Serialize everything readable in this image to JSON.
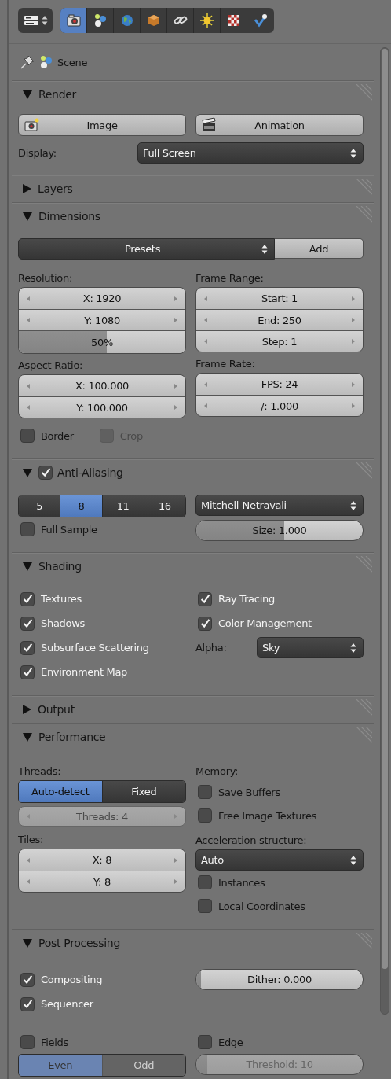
{
  "editor_selector": {
    "kind": "properties"
  },
  "tabs": [
    {
      "kind": "camera",
      "selected": true
    },
    {
      "kind": "scene",
      "selected": false
    },
    {
      "kind": "world",
      "selected": false
    },
    {
      "kind": "object",
      "selected": false
    },
    {
      "kind": "constraints",
      "selected": false
    },
    {
      "kind": "sun",
      "selected": false
    },
    {
      "kind": "texture",
      "selected": false
    },
    {
      "kind": "particles",
      "selected": false
    }
  ],
  "context": {
    "label": "Scene"
  },
  "panels": [
    {
      "kind": "render",
      "title": "Render",
      "expanded": true,
      "buttons": [
        {
          "kind": "image",
          "label": "Image"
        },
        {
          "kind": "animation",
          "label": "Animation"
        }
      ],
      "display": {
        "label": "Display:",
        "value": "Full Screen"
      }
    },
    {
      "title": "Layers",
      "expanded": false
    },
    {
      "kind": "dimensions",
      "title": "Dimensions",
      "expanded": true,
      "presets": "Presets",
      "add": "Add",
      "resolution": {
        "label": "Resolution:",
        "fields": [
          "X: 1920",
          "Y: 1080"
        ],
        "percent": {
          "text": "50%",
          "level": 0.5
        }
      },
      "frame_range": {
        "label": "Frame Range:",
        "fields": [
          "Start: 1",
          "End: 250",
          "Step: 1"
        ]
      },
      "aspect": {
        "label": "Aspect Ratio:",
        "fields": [
          "X: 100.000",
          "Y: 100.000"
        ]
      },
      "frame_rate": {
        "label": "Frame Rate:",
        "fields": [
          "FPS: 24",
          "/: 1.000"
        ]
      },
      "checks": [
        {
          "label": "Border",
          "checked": false,
          "disabled": false
        },
        {
          "label": "Crop",
          "checked": false,
          "disabled": true
        }
      ]
    },
    {
      "kind": "antialiasing",
      "title": "Anti-Aliasing",
      "expanded": true,
      "enabled": true,
      "samples": [
        {
          "label": "5",
          "selected": false
        },
        {
          "label": "8",
          "selected": true
        },
        {
          "label": "11",
          "selected": false
        },
        {
          "label": "16",
          "selected": false
        }
      ],
      "filter": "Mitchell-Netravali",
      "full_sample": {
        "label": "Full Sample",
        "checked": false
      },
      "size": {
        "text": "Size: 1.000",
        "level": 0.5
      }
    },
    {
      "kind": "shading",
      "title": "Shading",
      "expanded": true,
      "left": [
        {
          "label": "Textures",
          "checked": true
        },
        {
          "label": "Shadows",
          "checked": true
        },
        {
          "label": "Subsurface Scattering",
          "checked": true
        },
        {
          "label": "Environment Map",
          "checked": true
        }
      ],
      "right": [
        {
          "label": "Ray Tracing",
          "checked": true
        },
        {
          "label": "Color Management",
          "checked": true
        }
      ],
      "alpha": {
        "label": "Alpha:",
        "value": "Sky"
      }
    },
    {
      "title": "Output",
      "expanded": false
    },
    {
      "kind": "performance",
      "title": "Performance",
      "expanded": true,
      "threads_label": "Threads:",
      "thread_modes": [
        {
          "label": "Auto-detect",
          "selected": true
        },
        {
          "label": "Fixed",
          "selected": false
        }
      ],
      "threads": {
        "text": "Threads: 4",
        "disabled": true
      },
      "tiles_label": "Tiles:",
      "tiles": [
        "X: 8",
        "Y: 8"
      ],
      "memory_label": "Memory:",
      "memory": [
        {
          "label": "Save Buffers",
          "checked": false
        },
        {
          "label": "Free Image Textures",
          "checked": false
        }
      ],
      "accel_label": "Acceleration structure:",
      "accel": "Auto",
      "accel_checks": [
        {
          "label": "Instances",
          "checked": false
        },
        {
          "label": "Local Coordinates",
          "checked": false
        }
      ]
    },
    {
      "kind": "postprocessing",
      "title": "Post Processing",
      "expanded": true,
      "checks": [
        {
          "label": "Compositing",
          "checked": true
        },
        {
          "label": "Sequencer",
          "checked": true
        }
      ],
      "dither": {
        "text": "Dither: 0.000",
        "level": 0
      },
      "fields": {
        "label": "Fields",
        "checked": false
      },
      "field_order": [
        {
          "label": "Even",
          "selected": true
        },
        {
          "label": "Odd",
          "selected": false
        }
      ],
      "edge": {
        "label": "Edge",
        "checked": false
      },
      "threshold": {
        "text": "Threshold: 10",
        "level": 0.04
      }
    }
  ]
}
